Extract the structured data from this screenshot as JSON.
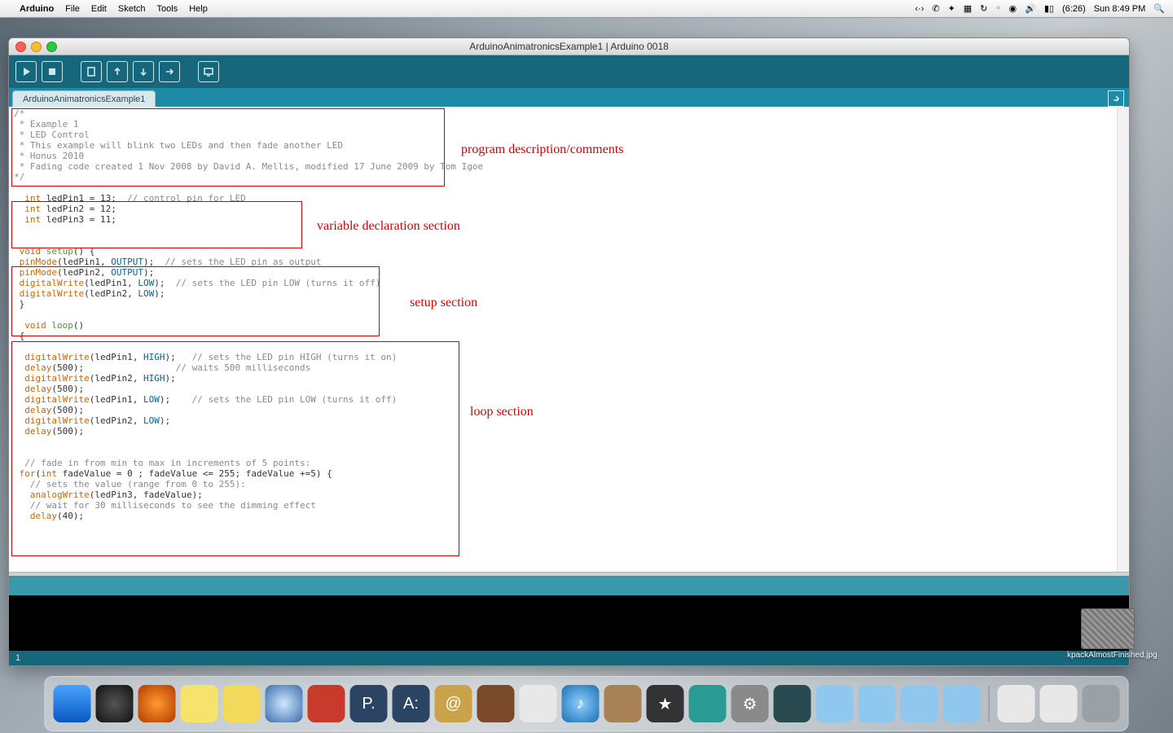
{
  "menubar": {
    "app": "Arduino",
    "items": [
      "File",
      "Edit",
      "Sketch",
      "Tools",
      "Help"
    ],
    "clock_small": "(6:26)",
    "clock": "Sun 8:49 PM"
  },
  "window": {
    "title": "ArduinoAnimatronicsExample1 | Arduino 0018",
    "tab": "ArduinoAnimatronicsExample1",
    "line_number": "1"
  },
  "annotations": {
    "a1": "program description/comments",
    "a2": "variable declaration section",
    "a3": "setup section",
    "a4": "loop section"
  },
  "code": {
    "comment_lines": [
      "/*",
      " * Example 1",
      " * LED Control",
      " * This example will blink two LEDs and then fade another LED",
      " * Honus 2010",
      " * Fading code created 1 Nov 2008 by David A. Mellis, modified 17 June 2009 by Tom Igoe",
      "*/"
    ],
    "vars": {
      "kw": "int",
      "l1_name": " ledPin1 = 13;  ",
      "l1_cmt": "// control pin for LED",
      "l2": " ledPin2 = 12;",
      "l3": " ledPin3 = 11;"
    },
    "setup": {
      "sig_kw": " void ",
      "sig_name": "setup",
      "sig_paren": "() {",
      "pm": "pinMode",
      "dw": "digitalWrite",
      "p1": "(ledPin1, ",
      "p2": "(ledPin2, ",
      "OUT": "OUTPUT",
      "LOW": "LOW",
      "close": ");",
      "cmt1": "  // sets the LED pin as output",
      "cmt2": "  // sets the LED pin LOW (turns it off)",
      "end": " }"
    },
    "loop": {
      "sig_kw": "  void ",
      "sig_name": "loop",
      "sig_paren": "()",
      "ob": " {",
      "dw": "digitalWrite",
      "dl": "delay",
      "aw": "analogWrite",
      "p1": "(ledPin1, ",
      "p2": "(ledPin2, ",
      "p3": "(ledPin3, fadeValue);",
      "HIGH": "HIGH",
      "LOW": "LOW",
      "close": ");",
      "d500": "(500);",
      "cmt_on": "   // sets the LED pin HIGH (turns it on)",
      "cmt_wait": "                 // waits 500 milliseconds",
      "cmt_off": "    // sets the LED pin LOW (turns it off)",
      "fade_cmt": "  // fade in from min to max in increments of 5 points:",
      "for_kw": "for",
      "for_int": "int",
      "for_body": " fadeValue = 0 ; fadeValue <= 255; fadeValue +=5) {",
      "for_open": "(",
      "set_cmt": "   // sets the value (range from 0 to 255):",
      "wait_cmt": "   // wait for 30 milliseconds to see the dimming effect",
      "d40": "(40);"
    }
  },
  "desktop_file": {
    "name": "kpackAlmostFinished.jpg"
  },
  "dock": {
    "count": 27
  }
}
